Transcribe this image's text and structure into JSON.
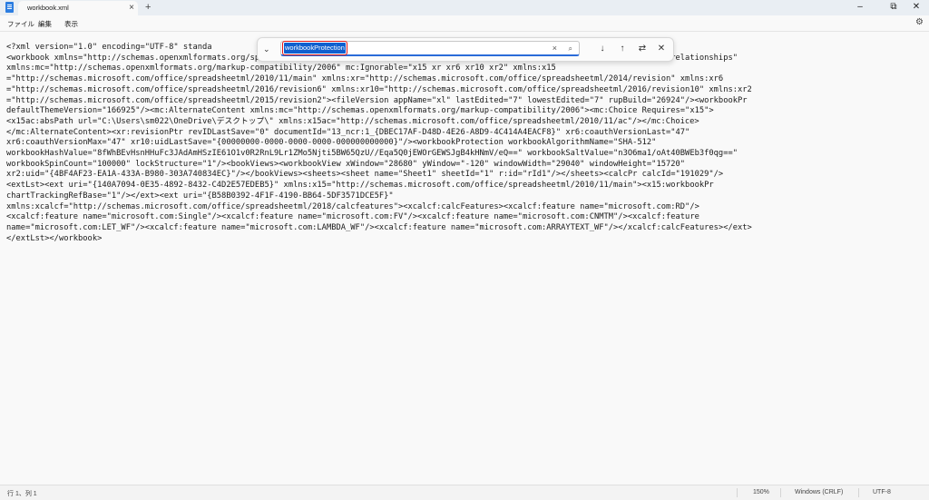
{
  "titlebar": {
    "tab_label": "workbook.xml",
    "tab_close": "×",
    "new_tab": "+",
    "minimize": "–",
    "maximize": "⧉",
    "close": "✕"
  },
  "menu": {
    "file": "ファイル",
    "edit": "編集",
    "view": "表示",
    "settings_icon": "⚙"
  },
  "find": {
    "query": "workbookProtection",
    "chevron": "⌄",
    "clear_icon": "×",
    "search_icon": "⌕",
    "next_icon": "↓",
    "prev_icon": "↑",
    "replace_icon": "⇄",
    "close_icon": "✕"
  },
  "editor": {
    "lines": [
      "<?xml version=\"1.0\" encoding=\"UTF-8\" standa",
      "<workbook xmlns=\"http://schemas.openxmlformats.org/spreadsheetml/2006/main\" xmlns:r=\"http://schemas.openxmlformats.org/officeDocument/2006/relationships\"",
      "xmlns:mc=\"http://schemas.openxmlformats.org/markup-compatibility/2006\" mc:Ignorable=\"x15 xr xr6 xr10 xr2\" xmlns:x15",
      "=\"http://schemas.microsoft.com/office/spreadsheetml/2010/11/main\" xmlns:xr=\"http://schemas.microsoft.com/office/spreadsheetml/2014/revision\" xmlns:xr6",
      "=\"http://schemas.microsoft.com/office/spreadsheetml/2016/revision6\" xmlns:xr10=\"http://schemas.microsoft.com/office/spreadsheetml/2016/revision10\" xmlns:xr2",
      "=\"http://schemas.microsoft.com/office/spreadsheetml/2015/revision2\"><fileVersion appName=\"xl\" lastEdited=\"7\" lowestEdited=\"7\" rupBuild=\"26924\"/><workbookPr",
      "defaultThemeVersion=\"166925\"/><mc:AlternateContent xmlns:mc=\"http://schemas.openxmlformats.org/markup-compatibility/2006\"><mc:Choice Requires=\"x15\">",
      "<x15ac:absPath url=\"C:\\Users\\sm022\\OneDrive\\デスクトップ\\\" xmlns:x15ac=\"http://schemas.microsoft.com/office/spreadsheetml/2010/11/ac\"/></mc:Choice>",
      "</mc:AlternateContent><xr:revisionPtr revIDLastSave=\"0\" documentId=\"13_ncr:1_{DBEC17AF-D48D-4E26-A8D9-4C414A4EACF8}\" xr6:coauthVersionLast=\"47\"",
      "xr6:coauthVersionMax=\"47\" xr10:uidLastSave=\"{00000000-0000-0000-0000-000000000000}\"/><workbookProtection workbookAlgorithmName=\"SHA-512\"",
      "workbookHashValue=\"8fWhBEvHsnHHuFc3JAdAmHSzIE61O1v0R2RnL9Lr1ZMo5Njti5BW65QzU//Eqa5Q0jEWOrGEWSJgB4kHNmV/eQ==\" workbookSaltValue=\"n3O6ma1/oAt40BWEb3f0qg==\"",
      "workbookSpinCount=\"100000\" lockStructure=\"1\"/><bookViews><workbookView xWindow=\"28680\" yWindow=\"-120\" windowWidth=\"29040\" windowHeight=\"15720\"",
      "xr2:uid=\"{4BF4AF23-EA1A-433A-B980-303A740834EC}\"/></bookViews><sheets><sheet name=\"Sheet1\" sheetId=\"1\" r:id=\"rId1\"/></sheets><calcPr calcId=\"191029\"/>",
      "<extLst><ext uri=\"{140A7094-0E35-4892-8432-C4D2E57EDEB5}\" xmlns:x15=\"http://schemas.microsoft.com/office/spreadsheetml/2010/11/main\"><x15:workbookPr",
      "chartTrackingRefBase=\"1\"/></ext><ext uri=\"{B58B0392-4F1F-4190-BB64-5DF3571DCE5F}\"",
      "xmlns:xcalcf=\"http://schemas.microsoft.com/office/spreadsheetml/2018/calcfeatures\"><xcalcf:calcFeatures><xcalcf:feature name=\"microsoft.com:RD\"/>",
      "<xcalcf:feature name=\"microsoft.com:Single\"/><xcalcf:feature name=\"microsoft.com:FV\"/><xcalcf:feature name=\"microsoft.com:CNMTM\"/><xcalcf:feature",
      "name=\"microsoft.com:LET_WF\"/><xcalcf:feature name=\"microsoft.com:LAMBDA_WF\"/><xcalcf:feature name=\"microsoft.com:ARRAYTEXT_WF\"/></xcalcf:calcFeatures></ext>",
      "</extLst></workbook>"
    ]
  },
  "status": {
    "position": "行 1、列 1",
    "zoom": "150%",
    "line_ending": "Windows (CRLF)",
    "encoding": "UTF-8"
  },
  "colors": {
    "accent": "#0f5fcf",
    "highlight_outline": "#e01616"
  }
}
